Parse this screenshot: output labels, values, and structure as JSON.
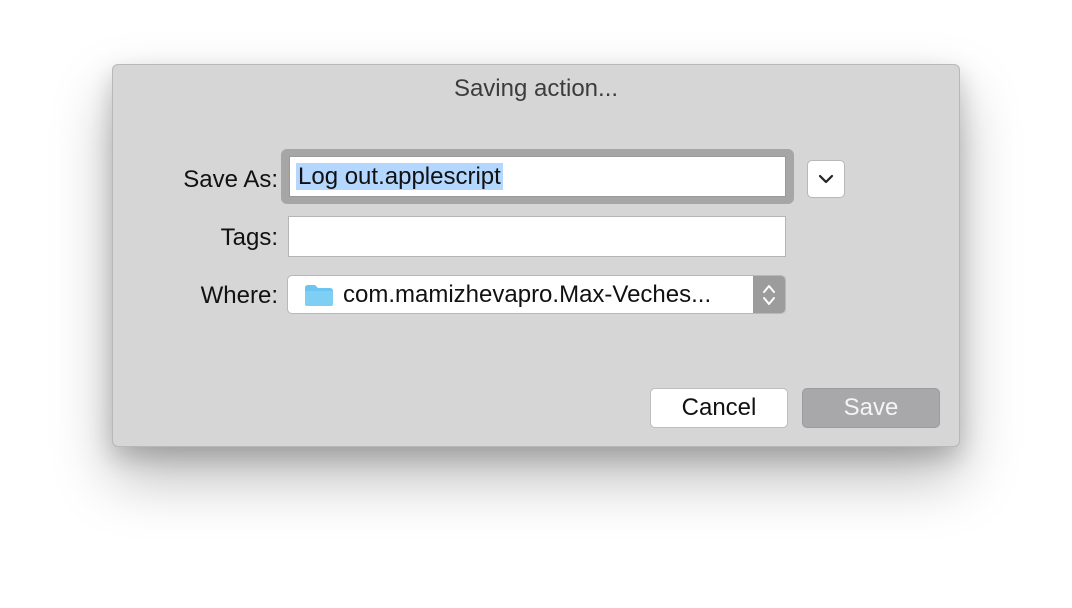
{
  "dialog": {
    "title": "Saving action..."
  },
  "fields": {
    "save_as_label": "Save As:",
    "save_as_value": "Log out.applescript",
    "tags_label": "Tags:",
    "tags_value": "",
    "where_label": "Where:",
    "where_value": "com.mamizhevapro.Max-Veches..."
  },
  "buttons": {
    "cancel_label": "Cancel",
    "save_label": "Save"
  },
  "icons": {
    "expand": "chevron-down-icon",
    "folder": "folder-icon",
    "stepper": "up-down-arrows-icon"
  },
  "colors": {
    "selection": "#b3d7ff",
    "folder": "#6cc4f2",
    "dialog_bg": "#d6d6d6",
    "save_disabled": "#a8a8ab"
  }
}
